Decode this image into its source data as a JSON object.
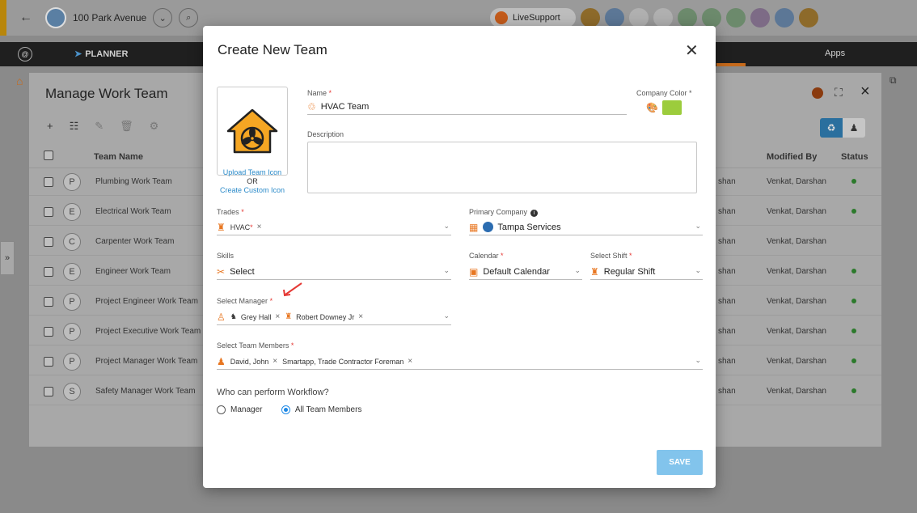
{
  "topbar": {
    "back_icon": "arrow-left-icon",
    "project_name": "100 Park Avenue",
    "live_support": "LiveSupport"
  },
  "nav": {
    "planner": "PLANNER",
    "apps": "Apps"
  },
  "panel": {
    "title": "Manage Work Team",
    "columns": {
      "name": "Team Name",
      "modified_by": "Modified By",
      "status": "Status"
    },
    "rows": [
      {
        "name": "Plumbing Work Team",
        "cut": "shan",
        "modified_by": "Venkat, Darshan",
        "active": true,
        "icon": "P"
      },
      {
        "name": "Electrical Work Team",
        "cut": "shan",
        "modified_by": "Venkat, Darshan",
        "active": true,
        "icon": "E"
      },
      {
        "name": "Carpenter Work Team",
        "cut": "shan",
        "modified_by": "Venkat, Darshan",
        "active": false,
        "icon": "C"
      },
      {
        "name": "Engineer Work Team",
        "cut": "shan",
        "modified_by": "Venkat, Darshan",
        "active": true,
        "icon": "E"
      },
      {
        "name": "Project Engineer Work Team",
        "cut": "shan",
        "modified_by": "Venkat, Darshan",
        "active": true,
        "icon": "P"
      },
      {
        "name": "Project Executive Work Team",
        "cut": "shan",
        "modified_by": "Venkat, Darshan",
        "active": true,
        "icon": "P"
      },
      {
        "name": "Project Manager Work Team",
        "cut": "shan",
        "modified_by": "Venkat, Darshan",
        "active": true,
        "icon": "P"
      },
      {
        "name": "Safety Manager Work Team",
        "cut": "shan",
        "modified_by": "Venkat, Darshan",
        "active": true,
        "icon": "S"
      }
    ]
  },
  "modal": {
    "title": "Create New Team",
    "upload_icon": "Upload Team Icon",
    "or": "OR",
    "create_icon": "Create Custom Icon",
    "name_label": "Name",
    "name_value": "HVAC Team",
    "company_color_label": "Company Color",
    "company_color": "#9ccc3c",
    "description_label": "Description",
    "trades_label": "Trades",
    "trades_chip": "HVAC",
    "primary_company_label": "Primary Company",
    "primary_company_value": "Tampa Services",
    "skills_label": "Skills",
    "skills_value": "Select",
    "calendar_label": "Calendar",
    "calendar_value": "Default Calendar",
    "shift_label": "Select Shift",
    "shift_value": "Regular Shift",
    "manager_label": "Select Manager",
    "managers": [
      "Grey Hall",
      "Robert Downey Jr"
    ],
    "members_label": "Select Team Members",
    "members": [
      "David, John",
      "Smartapp, Trade Contractor Foreman"
    ],
    "workflow_label": "Who can perform Workflow?",
    "workflow_options": [
      "Manager",
      "All Team Members"
    ],
    "workflow_selected": "All Team Members",
    "save": "SAVE"
  }
}
